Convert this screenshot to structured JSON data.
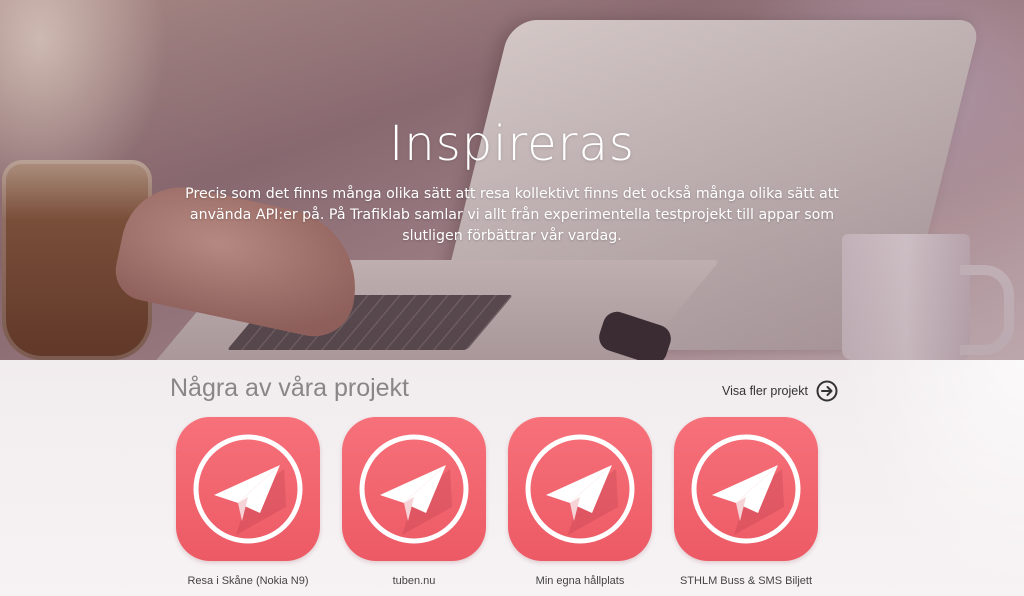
{
  "hero": {
    "title": "Inspireras",
    "text": "Precis som det finns många olika sätt att resa kollektivt finns det också många olika sätt att använda API:er på. På Trafiklab samlar vi allt från experimentella testprojekt till appar som slutligen förbättrar vår vardag."
  },
  "projects": {
    "title": "Några av våra projekt",
    "more_label": "Visa fler projekt",
    "more_icon": "arrow-right-circle-icon",
    "items": [
      {
        "label": "Resa i Skåne (Nokia N9)",
        "icon": "paper-plane-icon"
      },
      {
        "label": "tuben.nu",
        "icon": "paper-plane-icon"
      },
      {
        "label": "Min egna hållplats",
        "icon": "paper-plane-icon"
      },
      {
        "label": "STHLM Buss & SMS Biljett",
        "icon": "paper-plane-icon"
      }
    ]
  },
  "colors": {
    "icon_tile": "#f06872",
    "text_light": "#ffffff",
    "heading_gray": "#8a8587"
  }
}
